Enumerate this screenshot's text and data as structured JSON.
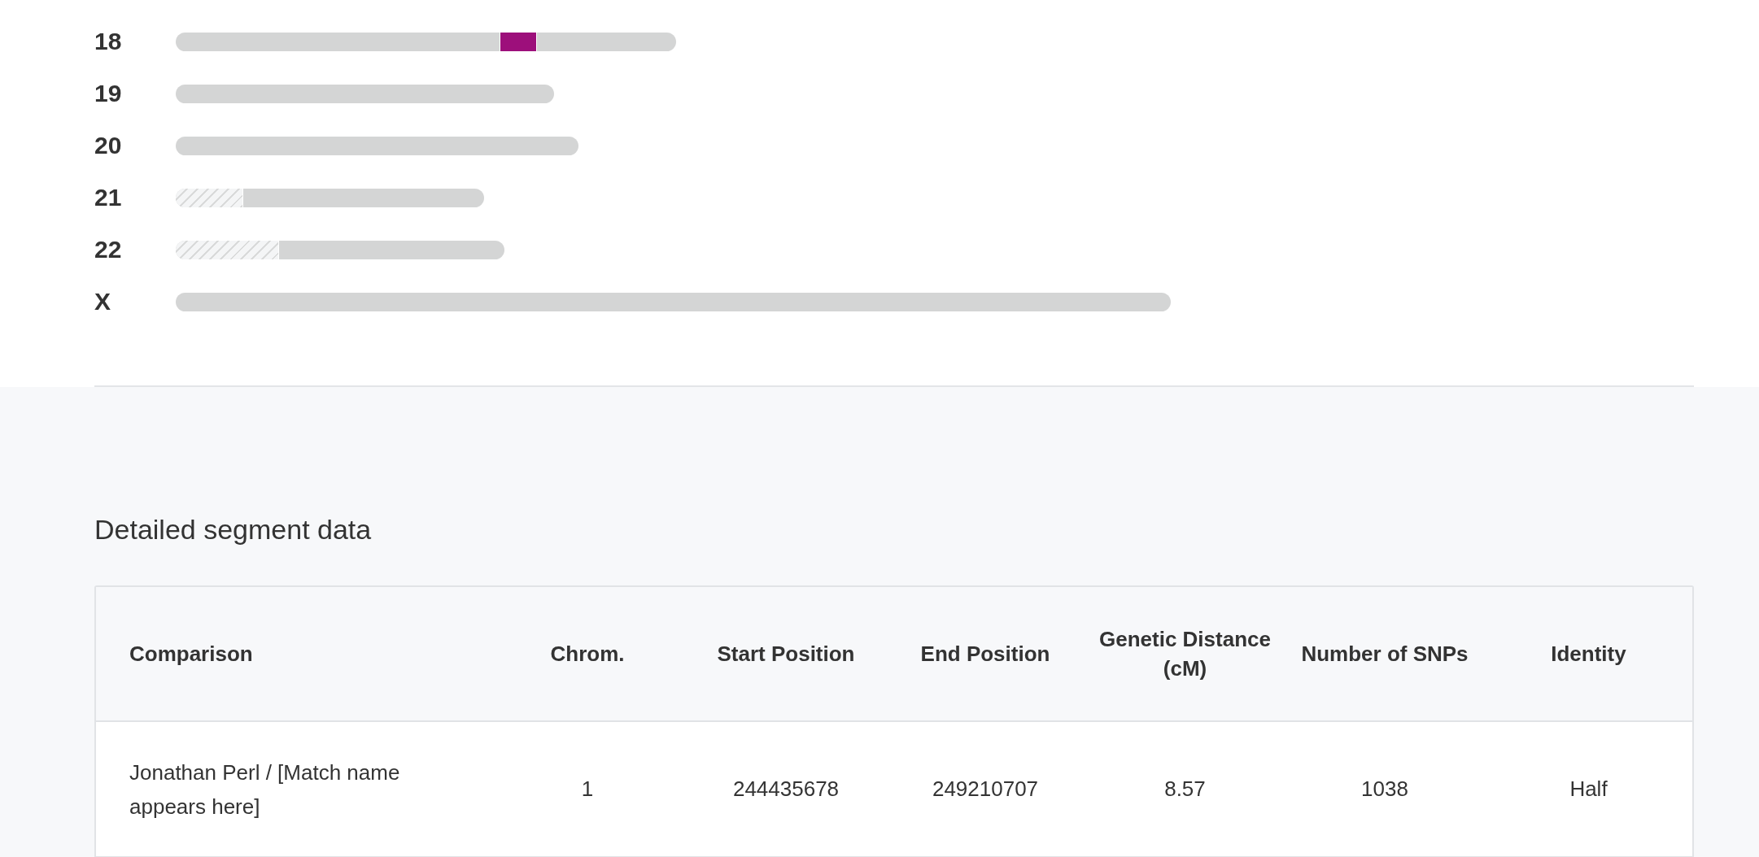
{
  "chromosomes": [
    {
      "label": "18",
      "matched": true
    },
    {
      "label": "19",
      "matched": false
    },
    {
      "label": "20",
      "matched": false
    },
    {
      "label": "21",
      "matched": false
    },
    {
      "label": "22",
      "matched": false
    },
    {
      "label": "X",
      "matched": false
    }
  ],
  "section_title": "Detailed segment data",
  "table": {
    "columns": [
      "Comparison",
      "Chrom.",
      "Start Position",
      "End Position",
      "Genetic Distance (cM)",
      "Number of SNPs",
      "Identity"
    ],
    "rows": [
      [
        "Jonathan Perl / [Match name appears here]",
        "1",
        "244435678",
        "249210707",
        "8.57",
        "1038",
        "Half"
      ]
    ]
  }
}
